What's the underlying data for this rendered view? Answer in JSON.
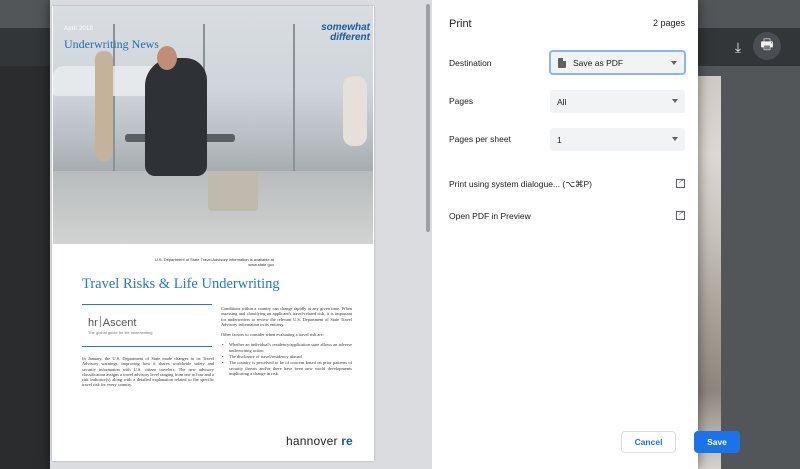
{
  "print": {
    "title": "Print",
    "page_count": "2 pages",
    "destination_label": "Destination",
    "destination_value": "Save as PDF",
    "pages_label": "Pages",
    "pages_value": "All",
    "pages_per_sheet_label": "Pages per sheet",
    "pages_per_sheet_value": "1",
    "system_dialog_link": "Print using system dialogue... (⌥⌘P)",
    "open_pdf_link": "Open PDF in Preview",
    "cancel_label": "Cancel",
    "save_label": "Save"
  },
  "preview": {
    "issue_date": "April 2018",
    "heading": "Underwriting News",
    "brand_tagline_1": "somewhat",
    "brand_tagline_2": "different",
    "advisory_note": "U.S. Department of State Travel Advisory information is available at www.state.gov",
    "article_title": "Travel Risks & Life Underwriting",
    "logo_hr": "hr",
    "logo_name": "Ascent",
    "logo_tag": "The global guide for life underwriting",
    "col_left": "In January, the U.S. Department of State made changes to its Travel Advisory warnings, improving how it shares worldwide safety and security information with U.S. citizen travelers. The new advisory classification assigns a travel advisory level ranging from one to four and a risk indicator(s) along with a detailed explanation related to the specific travel risk for every country.",
    "col_right_p1": "Conditions within a country can change rapidly at any given time. When assessing and classifying an applicant's travel-related risk, it is important for underwriters to review the relevant U.S. Department of State Travel Advisory information in its entirety.",
    "col_right_p2": "Other factors to consider when evaluating a travel risk are:",
    "bullets": [
      "Whether an individual's residency/application state allows an adverse underwriting action",
      "The disclosure of travel/residency abroad",
      "The country is perceived to be of concern based on prior patterns of security threats and/or there have been new world developments implicating a change in risk."
    ],
    "footer_brand": "hannover",
    "footer_brand_suffix": "re"
  },
  "toolbar": {
    "download_icon": "download-icon",
    "print_icon": "print-icon"
  },
  "colors": {
    "accent": "#1a73e8",
    "brand_blue": "#1e7bc4"
  }
}
